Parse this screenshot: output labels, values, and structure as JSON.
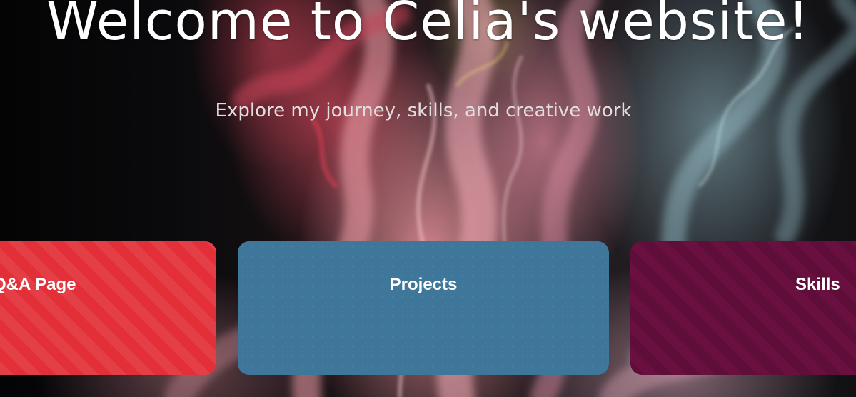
{
  "hero": {
    "title": "Welcome to Celia's website!",
    "subtitle": "Explore my journey, skills, and creative work"
  },
  "cards": [
    {
      "label": "Q&A Page",
      "color": "#e22f38",
      "pattern": "diagonal-stripes"
    },
    {
      "label": "Projects",
      "color": "#3f779b",
      "pattern": "dots"
    },
    {
      "label": "Skills",
      "color": "#6a1040",
      "pattern": "diagonal-stripes"
    }
  ],
  "background": {
    "description_colors": [
      "#050506",
      "#e0909f",
      "#9cc0c8",
      "#c8466a"
    ]
  }
}
